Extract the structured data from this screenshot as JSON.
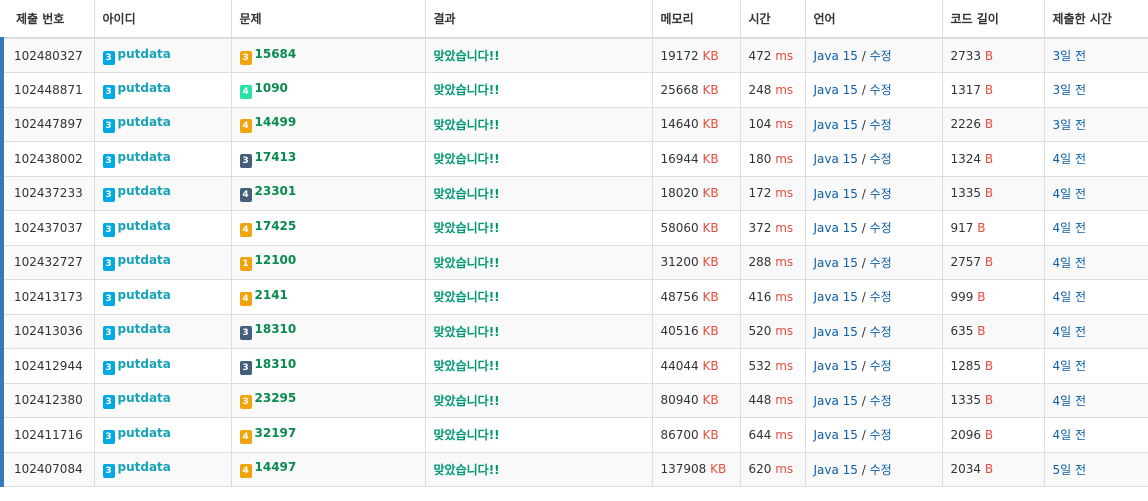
{
  "headers": [
    "제출 번호",
    "아이디",
    "문제",
    "결과",
    "메모리",
    "시간",
    "언어",
    "코드 길이",
    "제출한 시간"
  ],
  "colors": {
    "accent": "#337ab7",
    "user": "#17a2b8",
    "problem": "#0a8a4f",
    "result": "#009874",
    "unit": "#e74c3c",
    "link": "#0d5fa6"
  },
  "units": {
    "memory": "KB",
    "time": "ms",
    "code": "B"
  },
  "lang_sep": "/",
  "rows": [
    {
      "id": "102480327",
      "user_tier": "3",
      "user_tier_color": "blue",
      "user": "putdata",
      "prob_tier": "3",
      "prob_tier_color": "orange",
      "problem": "15684",
      "result": "맞았습니다!!",
      "memory": "19172",
      "time": "472",
      "lang": "Java 15",
      "edit": "수정",
      "code": "2733",
      "submitted": "3일 전"
    },
    {
      "id": "102448871",
      "user_tier": "3",
      "user_tier_color": "blue",
      "user": "putdata",
      "prob_tier": "4",
      "prob_tier_color": "green",
      "problem": "1090",
      "result": "맞았습니다!!",
      "memory": "25668",
      "time": "248",
      "lang": "Java 15",
      "edit": "수정",
      "code": "1317",
      "submitted": "3일 전"
    },
    {
      "id": "102447897",
      "user_tier": "3",
      "user_tier_color": "blue",
      "user": "putdata",
      "prob_tier": "4",
      "prob_tier_color": "orange",
      "problem": "14499",
      "result": "맞았습니다!!",
      "memory": "14640",
      "time": "104",
      "lang": "Java 15",
      "edit": "수정",
      "code": "2226",
      "submitted": "3일 전"
    },
    {
      "id": "102438002",
      "user_tier": "3",
      "user_tier_color": "blue",
      "user": "putdata",
      "prob_tier": "3",
      "prob_tier_color": "dark",
      "problem": "17413",
      "result": "맞았습니다!!",
      "memory": "16944",
      "time": "180",
      "lang": "Java 15",
      "edit": "수정",
      "code": "1324",
      "submitted": "4일 전"
    },
    {
      "id": "102437233",
      "user_tier": "3",
      "user_tier_color": "blue",
      "user": "putdata",
      "prob_tier": "4",
      "prob_tier_color": "dark",
      "problem": "23301",
      "result": "맞았습니다!!",
      "memory": "18020",
      "time": "172",
      "lang": "Java 15",
      "edit": "수정",
      "code": "1335",
      "submitted": "4일 전"
    },
    {
      "id": "102437037",
      "user_tier": "3",
      "user_tier_color": "blue",
      "user": "putdata",
      "prob_tier": "4",
      "prob_tier_color": "orange",
      "problem": "17425",
      "result": "맞았습니다!!",
      "memory": "58060",
      "time": "372",
      "lang": "Java 15",
      "edit": "수정",
      "code": "917",
      "submitted": "4일 전"
    },
    {
      "id": "102432727",
      "user_tier": "3",
      "user_tier_color": "blue",
      "user": "putdata",
      "prob_tier": "1",
      "prob_tier_color": "orange",
      "problem": "12100",
      "result": "맞았습니다!!",
      "memory": "31200",
      "time": "288",
      "lang": "Java 15",
      "edit": "수정",
      "code": "2757",
      "submitted": "4일 전"
    },
    {
      "id": "102413173",
      "user_tier": "3",
      "user_tier_color": "blue",
      "user": "putdata",
      "prob_tier": "4",
      "prob_tier_color": "orange",
      "problem": "2141",
      "result": "맞았습니다!!",
      "memory": "48756",
      "time": "416",
      "lang": "Java 15",
      "edit": "수정",
      "code": "999",
      "submitted": "4일 전"
    },
    {
      "id": "102413036",
      "user_tier": "3",
      "user_tier_color": "blue",
      "user": "putdata",
      "prob_tier": "3",
      "prob_tier_color": "dark",
      "problem": "18310",
      "result": "맞았습니다!!",
      "memory": "40516",
      "time": "520",
      "lang": "Java 15",
      "edit": "수정",
      "code": "635",
      "submitted": "4일 전"
    },
    {
      "id": "102412944",
      "user_tier": "3",
      "user_tier_color": "blue",
      "user": "putdata",
      "prob_tier": "3",
      "prob_tier_color": "dark",
      "problem": "18310",
      "result": "맞았습니다!!",
      "memory": "44044",
      "time": "532",
      "lang": "Java 15",
      "edit": "수정",
      "code": "1285",
      "submitted": "4일 전"
    },
    {
      "id": "102412380",
      "user_tier": "3",
      "user_tier_color": "blue",
      "user": "putdata",
      "prob_tier": "3",
      "prob_tier_color": "orange",
      "problem": "23295",
      "result": "맞았습니다!!",
      "memory": "80940",
      "time": "448",
      "lang": "Java 15",
      "edit": "수정",
      "code": "1335",
      "submitted": "4일 전"
    },
    {
      "id": "102411716",
      "user_tier": "3",
      "user_tier_color": "blue",
      "user": "putdata",
      "prob_tier": "4",
      "prob_tier_color": "orange",
      "problem": "32197",
      "result": "맞았습니다!!",
      "memory": "86700",
      "time": "644",
      "lang": "Java 15",
      "edit": "수정",
      "code": "2096",
      "submitted": "4일 전"
    },
    {
      "id": "102407084",
      "user_tier": "3",
      "user_tier_color": "blue",
      "user": "putdata",
      "prob_tier": "4",
      "prob_tier_color": "orange",
      "problem": "14497",
      "result": "맞았습니다!!",
      "memory": "137908",
      "time": "620",
      "lang": "Java 15",
      "edit": "수정",
      "code": "2034",
      "submitted": "5일 전"
    }
  ]
}
